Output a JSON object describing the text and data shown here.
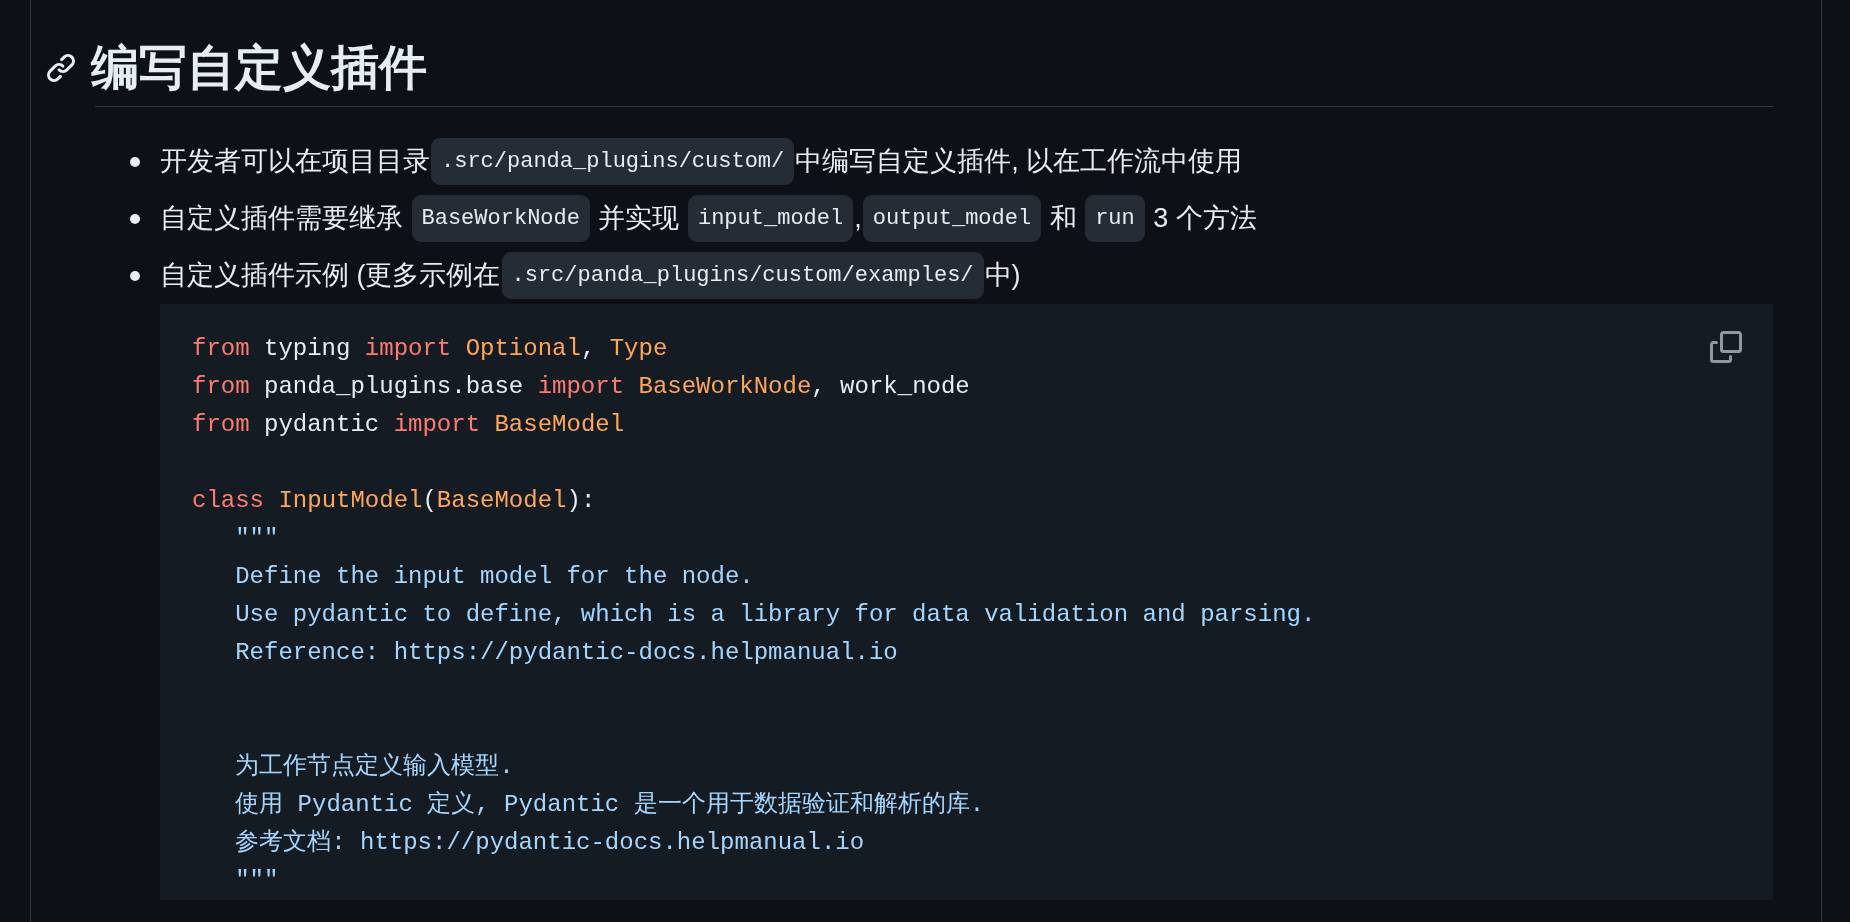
{
  "heading": {
    "text": "编写自定义插件"
  },
  "bullets": [
    {
      "segments": [
        {
          "kind": "text",
          "text": "开发者可以在项目目录"
        },
        {
          "kind": "code",
          "text": ".src/panda_plugins/custom/"
        },
        {
          "kind": "text",
          "text": "中编写自定义插件, 以在工作流中使用"
        }
      ]
    },
    {
      "segments": [
        {
          "kind": "text",
          "text": "自定义插件需要继承 "
        },
        {
          "kind": "code",
          "text": "BaseWorkNode"
        },
        {
          "kind": "text",
          "text": " 并实现 "
        },
        {
          "kind": "code",
          "text": "input_model"
        },
        {
          "kind": "text",
          "text": ","
        },
        {
          "kind": "code",
          "text": "output_model"
        },
        {
          "kind": "text",
          "text": " 和 "
        },
        {
          "kind": "code",
          "text": "run"
        },
        {
          "kind": "text",
          "text": " 3 个方法"
        }
      ]
    },
    {
      "segments": [
        {
          "kind": "text",
          "text": "自定义插件示例 (更多示例在"
        },
        {
          "kind": "code",
          "text": ".src/panda_plugins/custom/examples/"
        },
        {
          "kind": "text",
          "text": "中)"
        }
      ]
    }
  ],
  "code_block": {
    "lines": [
      {
        "kind": "code",
        "tokens": [
          {
            "kind": "keyword",
            "text": "from"
          },
          {
            "kind": "plain",
            "text": " typing "
          },
          {
            "kind": "keyword",
            "text": "import"
          },
          {
            "kind": "type",
            "text": " Optional"
          },
          {
            "kind": "plain",
            "text": ", "
          },
          {
            "kind": "type",
            "text": "Type"
          }
        ]
      },
      {
        "kind": "code",
        "tokens": [
          {
            "kind": "keyword",
            "text": "from"
          },
          {
            "kind": "plain",
            "text": " panda_plugins.base "
          },
          {
            "kind": "keyword",
            "text": "import"
          },
          {
            "kind": "type",
            "text": " BaseWorkNode"
          },
          {
            "kind": "plain",
            "text": ", work_node"
          }
        ]
      },
      {
        "kind": "code",
        "tokens": [
          {
            "kind": "keyword",
            "text": "from"
          },
          {
            "kind": "plain",
            "text": " pydantic "
          },
          {
            "kind": "keyword",
            "text": "import"
          },
          {
            "kind": "type",
            "text": " BaseModel"
          }
        ]
      },
      {
        "kind": "blank"
      },
      {
        "kind": "code",
        "tokens": [
          {
            "kind": "keyword",
            "text": "class"
          },
          {
            "kind": "type",
            "text": " InputModel"
          },
          {
            "kind": "plain",
            "text": "("
          },
          {
            "kind": "type",
            "text": "BaseModel"
          },
          {
            "kind": "plain",
            "text": "):"
          }
        ]
      },
      {
        "kind": "code",
        "tokens": [
          {
            "kind": "string",
            "text": "   \"\"\""
          }
        ]
      },
      {
        "kind": "code",
        "tokens": [
          {
            "kind": "string",
            "text": "   Define the input model for the node."
          }
        ]
      },
      {
        "kind": "code",
        "tokens": [
          {
            "kind": "string",
            "text": "   Use pydantic to define, which is a library for data validation and parsing."
          }
        ]
      },
      {
        "kind": "code",
        "tokens": [
          {
            "kind": "string",
            "text": "   Reference: https://pydantic-docs.helpmanual.io"
          }
        ]
      },
      {
        "kind": "blank"
      },
      {
        "kind": "blank"
      },
      {
        "kind": "code",
        "tokens": [
          {
            "kind": "string",
            "text": "   为工作节点定义输入模型."
          }
        ]
      },
      {
        "kind": "code",
        "tokens": [
          {
            "kind": "string",
            "text": "   使用 Pydantic 定义, Pydantic 是一个用于数据验证和解析的库."
          }
        ]
      },
      {
        "kind": "code",
        "tokens": [
          {
            "kind": "string",
            "text": "   参考文档: https://pydantic-docs.helpmanual.io"
          }
        ]
      },
      {
        "kind": "code",
        "tokens": [
          {
            "kind": "string",
            "text": "   \"\"\""
          }
        ]
      }
    ]
  }
}
